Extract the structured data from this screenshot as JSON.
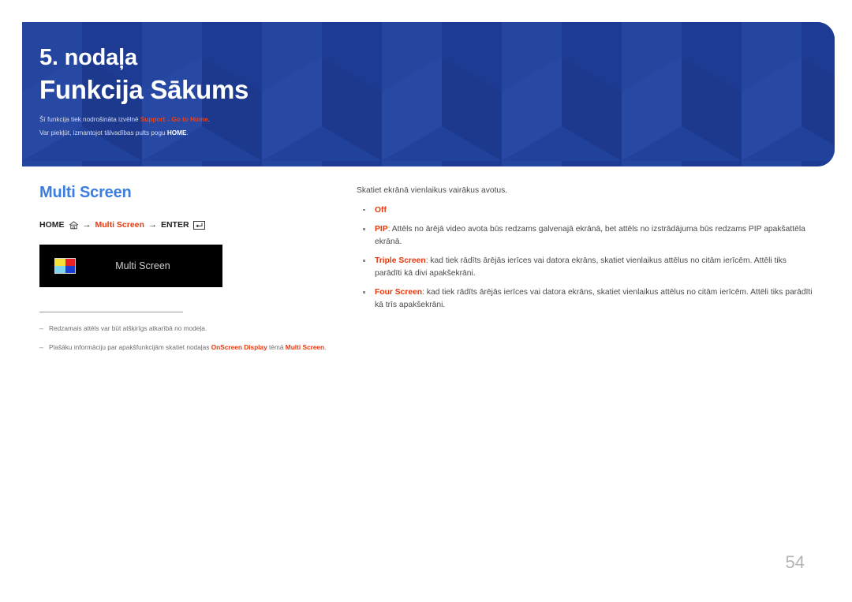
{
  "banner": {
    "chapter_number": "5. nodaļa",
    "chapter_title": "Funkcija Sākums",
    "note1_pre": "Šī funkcija tiek nodrošināta izvēlnē ",
    "note1_menu": "Support",
    "note1_arrow": "→",
    "note1_submenu": "Go to Home",
    "note1_post": ".",
    "note2_pre": "Var piekļūt, izmantojot tālvadības pults pogu ",
    "note2_strong": "HOME",
    "note2_post": "."
  },
  "left": {
    "section_title": "Multi Screen",
    "path": {
      "home": "HOME",
      "home_icon": "home-icon",
      "arrow1": "→",
      "target": "Multi Screen",
      "arrow2": "→",
      "enter": "ENTER",
      "enter_icon": "enter-key-icon"
    },
    "osd": {
      "label": "Multi Screen",
      "icon": "multi-screen-quad-icon",
      "icon_colors": {
        "top_left": "#f7e03a",
        "top_right": "#ea2127",
        "bottom_left": "#7fd5f0",
        "bottom_right": "#1b3fd4"
      }
    },
    "footnotes": [
      {
        "marker": "–",
        "parts": [
          {
            "type": "text",
            "text": "Redzamais attēls var būt atšķirīgs atkarībā no modeļa."
          }
        ]
      },
      {
        "marker": "–",
        "parts": [
          {
            "type": "text",
            "text": "Plašāku informāciju par apakšfunkcijām skatiet nodaļas "
          },
          {
            "type": "accent",
            "text": "OnScreen Display"
          },
          {
            "type": "text",
            "text": " tēmā "
          },
          {
            "type": "accent",
            "text": "Multi Screen"
          },
          {
            "type": "text",
            "text": "."
          }
        ]
      }
    ]
  },
  "right": {
    "intro": "Skatiet ekrānā vienlaikus vairākus avotus.",
    "options": [
      {
        "term": "Off",
        "desc": ""
      },
      {
        "term": "PIP",
        "desc": ": Attēls no ārējā video avota būs redzams galvenajā ekrānā, bet attēls no izstrādājuma būs redzams PIP apakšattēla ekrānā."
      },
      {
        "term": "Triple Screen",
        "desc": ": kad tiek rādīts ārējās ierīces vai datora ekrāns, skatiet vienlaikus attēlus no citām ierīcēm. Attēli tiks parādīti kā divi apakšekrāni."
      },
      {
        "term": "Four Screen",
        "desc": ": kad tiek rādīts ārējās ierīces vai datora ekrāns, skatiet vienlaikus attēlus no citām ierīcēm. Attēli tiks parādīti kā trīs apakšekrāni."
      }
    ]
  },
  "page_number": "54",
  "colors": {
    "banner_blue": "#20409a",
    "heading_blue": "#3b7de0",
    "accent_red": "#e8380d",
    "page_number_gray": "#b4b4b4"
  }
}
